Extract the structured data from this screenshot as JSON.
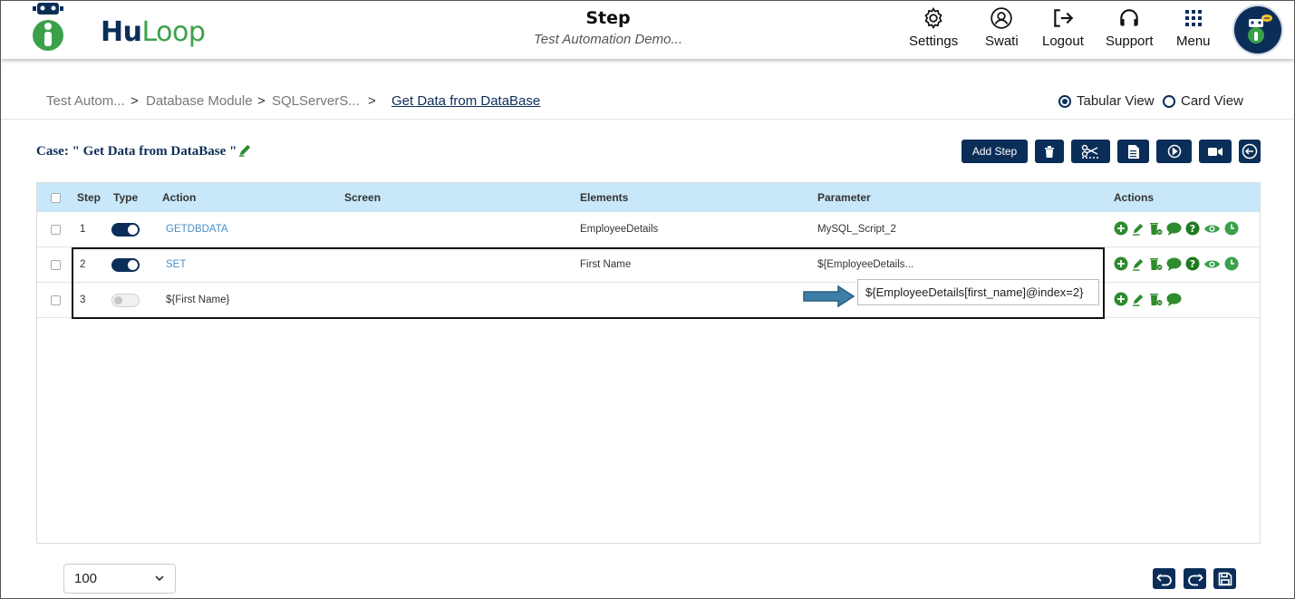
{
  "header": {
    "logo": {
      "hu": "Hu",
      "loop": "Loop",
      "icon": "robot-logo-icon"
    },
    "title": "Step",
    "subtitle": "Test Automation Demo...",
    "nav": [
      {
        "label": "Settings",
        "icon": "gear-icon"
      },
      {
        "label": "Swati",
        "icon": "user-icon"
      },
      {
        "label": "Logout",
        "icon": "logout-icon"
      },
      {
        "label": "Support",
        "icon": "headphones-icon"
      },
      {
        "label": "Menu",
        "icon": "grid-menu-icon"
      }
    ],
    "assistant_icon": "robot-assistant-icon"
  },
  "breadcrumb": {
    "items": [
      "Test Autom...",
      "Database Module",
      "SQLServerS...",
      "Get Data from DataBase"
    ],
    "separator": ">"
  },
  "view_toggle": {
    "tabular": "Tabular View",
    "card": "Card View",
    "selected": "Tabular View"
  },
  "case": {
    "prefix": "Case:",
    "name": "\" Get Data from DataBase \"",
    "edit_icon": "pencil-icon"
  },
  "toolbar": {
    "add_step": "Add Step",
    "icons": [
      "trash-icon",
      "scissors-icon",
      "document-icon",
      "play-circle-icon",
      "video-icon",
      "back-arrow-icon"
    ]
  },
  "table": {
    "columns": [
      "Step",
      "Type",
      "Action",
      "Screen",
      "Elements",
      "Parameter",
      "Actions"
    ],
    "rows": [
      {
        "step": "1",
        "type_on": true,
        "action": "GETDBDATA",
        "screen": "",
        "elements": "EmployeeDetails",
        "parameter": "MySQL_Script_2",
        "extra_actions": true
      },
      {
        "step": "2",
        "type_on": true,
        "action": "SET",
        "screen": "",
        "elements": "First Name",
        "parameter": "${EmployeeDetails...",
        "extra_actions": true
      },
      {
        "step": "3",
        "type_on": false,
        "action": "${First Name}",
        "screen": "",
        "elements": "",
        "parameter": "",
        "extra_actions": false
      }
    ],
    "row_action_icons": [
      "add-circle-icon",
      "edit-icon",
      "delete-icon",
      "comment-icon",
      "help-icon",
      "eye-icon",
      "clock-icon"
    ]
  },
  "tooltip": {
    "text": "${EmployeeDetails[first_name]@index=2}"
  },
  "footer": {
    "page_size": "100",
    "icons": [
      "undo-icon",
      "redo-icon",
      "save-icon"
    ]
  },
  "colors": {
    "brand_navy": "#0b2e59",
    "brand_green": "#3aa14a",
    "action_green": "#2e8b2e",
    "header_row": "#c8e8f9",
    "link_blue": "#4a90c8"
  }
}
